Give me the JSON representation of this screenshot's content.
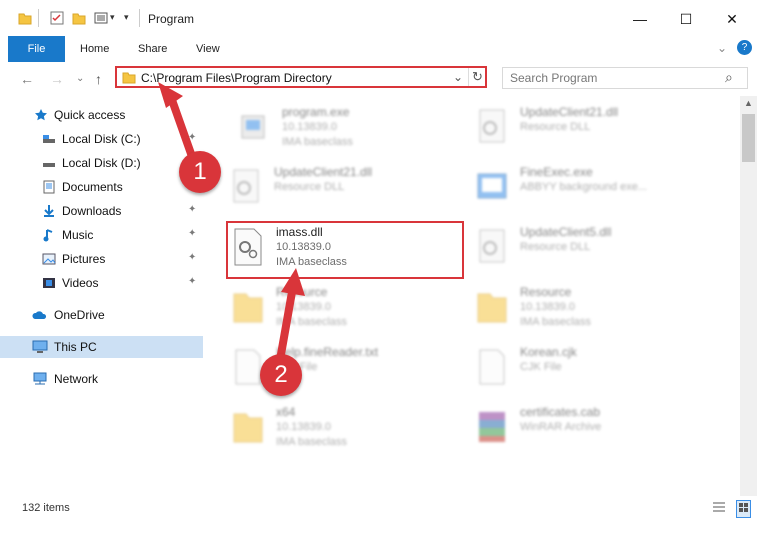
{
  "window": {
    "title": "Program",
    "minimize_glyph": "—",
    "maximize_glyph": "☐",
    "close_glyph": "✕"
  },
  "ribbon": {
    "tabs": [
      {
        "label": "File",
        "active": true
      },
      {
        "label": "Home"
      },
      {
        "label": "Share"
      },
      {
        "label": "View"
      }
    ],
    "help_glyph": "?",
    "expand_glyph": "⌄"
  },
  "nav": {
    "back_glyph": "←",
    "forward_glyph": "→",
    "recent_glyph": "⌄",
    "up_glyph": "↑",
    "address": "C:\\Program Files\\Program Directory",
    "dropdown_glyph": "⌄",
    "refresh_glyph": "↻",
    "search_placeholder": "Search Program",
    "search_glyph": "⌕"
  },
  "sidebar": {
    "items": [
      {
        "label": "Quick access",
        "icon": "star-icon",
        "pinned": false
      },
      {
        "label": "Local Disk (C:)",
        "icon": "drive-icon",
        "pinned": true
      },
      {
        "label": "Local Disk (D:)",
        "icon": "drive-icon",
        "pinned": true
      },
      {
        "label": "Documents",
        "icon": "documents-icon",
        "pinned": true
      },
      {
        "label": "Downloads",
        "icon": "downloads-icon",
        "pinned": true
      },
      {
        "label": "Music",
        "icon": "music-icon",
        "pinned": true
      },
      {
        "label": "Pictures",
        "icon": "pictures-icon",
        "pinned": true
      },
      {
        "label": "Videos",
        "icon": "videos-icon",
        "pinned": true
      },
      {
        "label": "OneDrive",
        "icon": "onedrive-icon",
        "pinned": false
      },
      {
        "label": "This PC",
        "icon": "computer-icon",
        "pinned": false,
        "selected": true
      },
      {
        "label": "Network",
        "icon": "network-icon",
        "pinned": false
      }
    ],
    "pin_glyph": "📌"
  },
  "files": [
    {
      "name": "program.exe",
      "version": "10.13839.0",
      "description": "IMA baseclass",
      "icon": "exe-icon",
      "blurred": true
    },
    {
      "name": "UpdateClient21.dll",
      "version": "",
      "description": "Resource DLL",
      "icon": "dll-icon",
      "blurred": true
    },
    {
      "name": "UpdateClient21.dll",
      "version": "",
      "description": "Resource DLL",
      "icon": "dll-icon",
      "blurred": true
    },
    {
      "name": "FineExec.exe",
      "version": "",
      "description": "ABBYY background exe...",
      "icon": "exe-icon",
      "blurred": true
    },
    {
      "name": "imass.dll",
      "version": "10.13839.0",
      "description": "IMA baseclass",
      "icon": "dll-icon",
      "blurred": false
    },
    {
      "name": "UpdateClient5.dll",
      "version": "",
      "description": "Resource DLL",
      "icon": "dll-icon",
      "blurred": true
    },
    {
      "name": "Resource",
      "version": "10.13839.0",
      "description": "IMA baseclass",
      "icon": "folder-icon",
      "blurred": true
    },
    {
      "name": "Resource",
      "version": "10.13839.0",
      "description": "IMA baseclass",
      "icon": "folder-icon",
      "blurred": true
    },
    {
      "name": "Help.fineReader.txt",
      "version": "",
      "description": "TXT File",
      "icon": "text-file-icon",
      "blurred": true
    },
    {
      "name": "Korean.cjk",
      "version": "",
      "description": "CJK File",
      "icon": "text-file-icon",
      "blurred": true
    },
    {
      "name": "x64",
      "version": "10.13839.0",
      "description": "IMA baseclass",
      "icon": "folder-icon",
      "blurred": true
    },
    {
      "name": "certificates.cab",
      "version": "",
      "description": "WinRAR Archive",
      "icon": "archive-icon",
      "blurred": true
    }
  ],
  "status": {
    "item_count": "132 items"
  },
  "annotations": {
    "step1": "1",
    "step2": "2",
    "accent": "#d9353a"
  },
  "colors": {
    "file_tab": "#1979ca",
    "selected_bg": "#cce0f4",
    "highlight": "#d9353a"
  }
}
